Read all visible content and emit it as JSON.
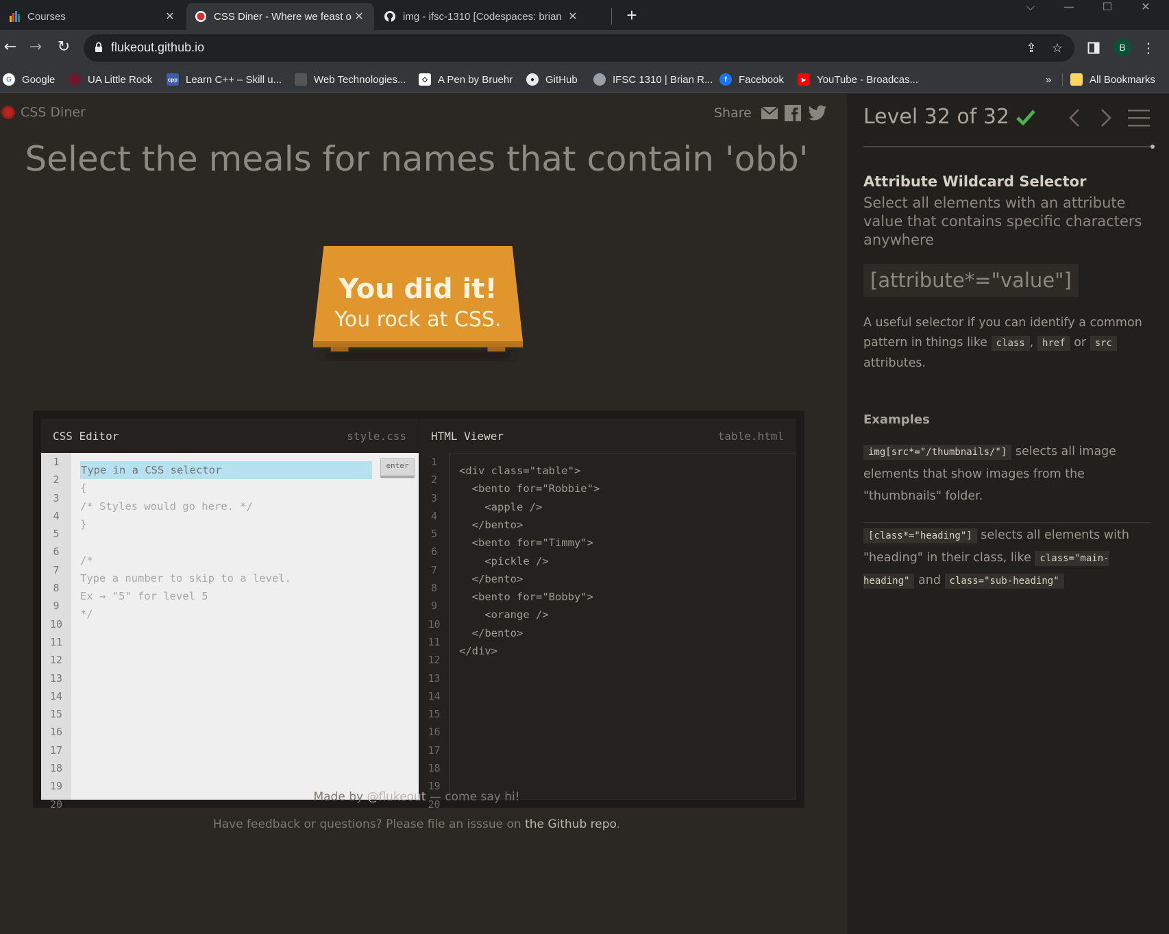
{
  "browser": {
    "tabs": [
      {
        "title": "Courses",
        "close": "✕"
      },
      {
        "title": "CSS Diner - Where we feast on CSS",
        "close": "✕"
      },
      {
        "title": "img - ifsc-1310 [Codespaces: brian",
        "close": "✕"
      }
    ],
    "url": "flukeout.github.io",
    "profile_initial": "B",
    "bookmarks": [
      {
        "label": "Google"
      },
      {
        "label": "UA Little Rock"
      },
      {
        "label": "Learn C++ – Skill u..."
      },
      {
        "label": "Web Technologies..."
      },
      {
        "label": "A Pen by Bruehr"
      },
      {
        "label": "GitHub"
      },
      {
        "label": "IFSC 1310 | Brian R..."
      },
      {
        "label": "Facebook"
      },
      {
        "label": "YouTube - Broadcas..."
      }
    ],
    "bookmarks_overflow": "»",
    "all_bookmarks": "All Bookmarks"
  },
  "site": {
    "logo": "CSS Diner",
    "share": "Share"
  },
  "instruction": "Select the meals for names that contain 'obb'",
  "winner": {
    "line1": "You did it!",
    "line2": "You rock at CSS."
  },
  "css_editor": {
    "title": "CSS Editor",
    "file": "style.css",
    "placeholder": "Type in a CSS selector",
    "enter_label": "enter",
    "lines": [
      "{",
      "/* Styles would go here. */",
      "}",
      "",
      "/*",
      "Type a number to skip to a level.",
      "Ex → \"5\" for level 5",
      "*/"
    ],
    "line_numbers": [
      "1",
      "2",
      "3",
      "4",
      "5",
      "6",
      "7",
      "8",
      "9",
      "10",
      "11",
      "12",
      "13",
      "14",
      "15",
      "16",
      "17",
      "18",
      "19",
      "20"
    ]
  },
  "html_viewer": {
    "title": "HTML Viewer",
    "file": "table.html",
    "lines": [
      "<div class=\"table\">",
      "  <bento for=\"Robbie\">",
      "    <apple />",
      "  </bento>",
      "  <bento for=\"Timmy\">",
      "    <pickle />",
      "  </bento>",
      "  <bento for=\"Bobby\">",
      "    <orange />",
      "  </bento>",
      "</div>"
    ],
    "line_numbers": [
      "1",
      "2",
      "3",
      "4",
      "5",
      "6",
      "7",
      "8",
      "9",
      "10",
      "11",
      "12",
      "13",
      "14",
      "15",
      "16",
      "17",
      "18",
      "19",
      "20"
    ]
  },
  "footer": {
    "made_by_prefix": "Made by ",
    "made_by_link": "@flukeout",
    "made_by_suffix": " — come say hi!",
    "feedback_prefix": "Have feedback or questions? Please file an isssue on ",
    "feedback_link": "the Github repo",
    "feedback_suffix": "."
  },
  "sidebar": {
    "level": "Level 32 of 32",
    "selector_name": "Attribute Wildcard Selector",
    "description": "Select all elements with an attribute value that contains specific characters anywhere",
    "syntax": "[attribute*=\"value\"]",
    "help_prefix": "A useful selector if you can identify a common pattern in things like ",
    "help_code1": "class",
    "help_sep1": ", ",
    "help_code2": "href",
    "help_sep2": " or ",
    "help_code3": "src",
    "help_suffix": " attributes.",
    "examples_title": "Examples",
    "ex1_code": "img[src*=\"/thumbnails/\"]",
    "ex1_text": " selects all image elements that show images from the \"thumbnails\" folder.",
    "ex2_code": "[class*=\"heading\"]",
    "ex2_text": " selects all elements with \"heading\" in their class, like ",
    "ex2_code2": "class=\"main-heading\"",
    "ex2_and": " and ",
    "ex2_code3": "class=\"sub-heading\""
  },
  "colors": {
    "accent_orange": "#e0962c",
    "check_green": "#4caf50",
    "logo_red": "#b3261e"
  }
}
